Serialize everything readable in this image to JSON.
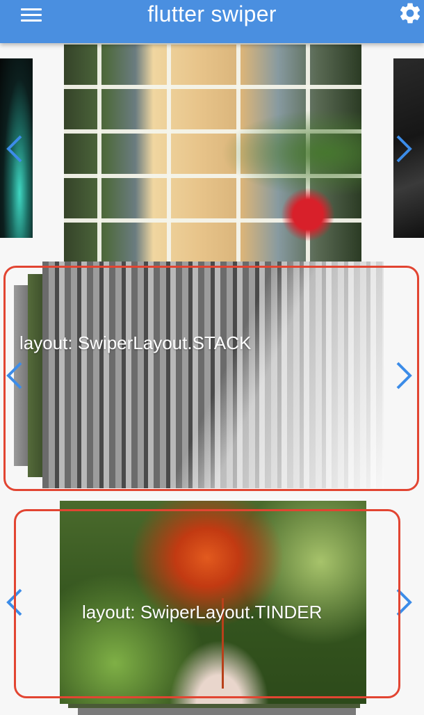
{
  "app": {
    "title": "flutter swiper"
  },
  "icons": {
    "menu": "menu-icon",
    "settings": "gear-icon",
    "prev": "chevron-left-icon",
    "next": "chevron-right-icon"
  },
  "colors": {
    "appbar": "#4a8fe0",
    "arrow": "#3c8ce8",
    "highlight": "#e24532"
  },
  "swipers": [
    {
      "name": "default-swiper",
      "image": "house window with ivy and red flowers"
    },
    {
      "name": "stack-swiper",
      "label": "layout: SwiperLayout.STACK",
      "image": "basalt columns cliff in mist"
    },
    {
      "name": "tinder-swiper",
      "label": "layout: SwiperLayout.TINDER",
      "image": "red maple leaf held in hand"
    }
  ]
}
